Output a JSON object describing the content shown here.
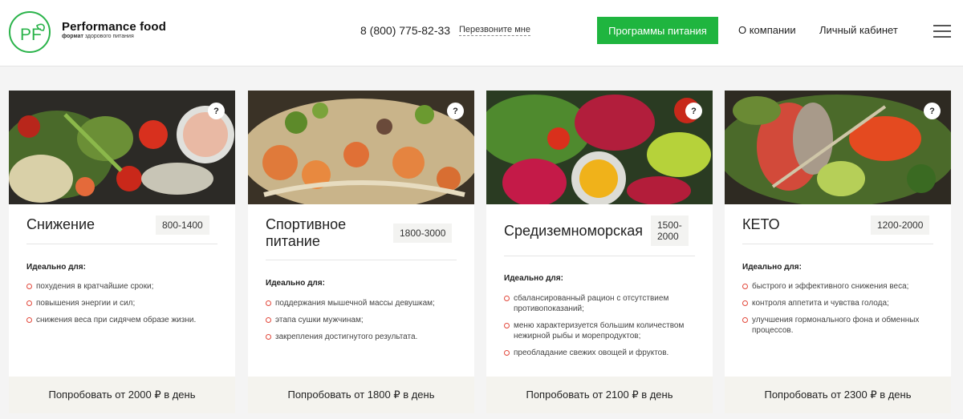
{
  "header": {
    "logo_text": "PF",
    "brand_name": "Performance food",
    "brand_tagline_bold": "формат",
    "brand_tagline_rest": "здорового питания",
    "phone": "8 (800) 775-82-33",
    "callback_label": "Перезвоните мне",
    "programs_button": "Программы питания",
    "nav_about": "О компании",
    "nav_account": "Личный кабинет",
    "menu_icon": "hamburger-icon",
    "accent_color": "#1fb53f"
  },
  "cards": [
    {
      "title_line1": "Снижение",
      "title_line2": "",
      "kcal_line1": "800-1400",
      "kcal_line2": "",
      "info_icon": "?",
      "ideal_label": "Идеально для:",
      "items": [
        "похудения в кратчайшие сроки;",
        "повышения энергии и сил;",
        "снижения веса при сидячем образе жизни."
      ],
      "cta": "Попробовать от 2000 ₽ в день"
    },
    {
      "title_line1": "Спортивное",
      "title_line2": "питание",
      "kcal_line1": "1800-3000",
      "kcal_line2": "",
      "info_icon": "?",
      "ideal_label": "Идеально для:",
      "items": [
        "поддержания мышечной массы девушкам;",
        "этапа сушки мужчинам;",
        "закрепления достигнутого результата."
      ],
      "cta": "Попробовать от 1800 ₽ в день"
    },
    {
      "title_line1": "Средиземноморская",
      "title_line2": "",
      "kcal_line1": "1500-",
      "kcal_line2": "2000",
      "info_icon": "?",
      "ideal_label": "Идеально для:",
      "items": [
        "сбалансированный рацион с отсутствием противопоказаний;",
        "меню характеризуется большим количеством нежирной рыбы и морепродуктов;",
        "преобладание свежих овощей и фруктов."
      ],
      "cta": "Попробовать от 2100 ₽ в день"
    },
    {
      "title_line1": "КЕТО",
      "title_line2": "",
      "kcal_line1": "1200-2000",
      "kcal_line2": "",
      "info_icon": "?",
      "ideal_label": "Идеально для:",
      "items": [
        "быстрого и эффективного снижения веса;",
        "контроля аппетита и чувства голода;",
        "улучшения гормонального фона и обменных процессов."
      ],
      "cta": "Попробовать от 2300 ₽ в день"
    }
  ]
}
